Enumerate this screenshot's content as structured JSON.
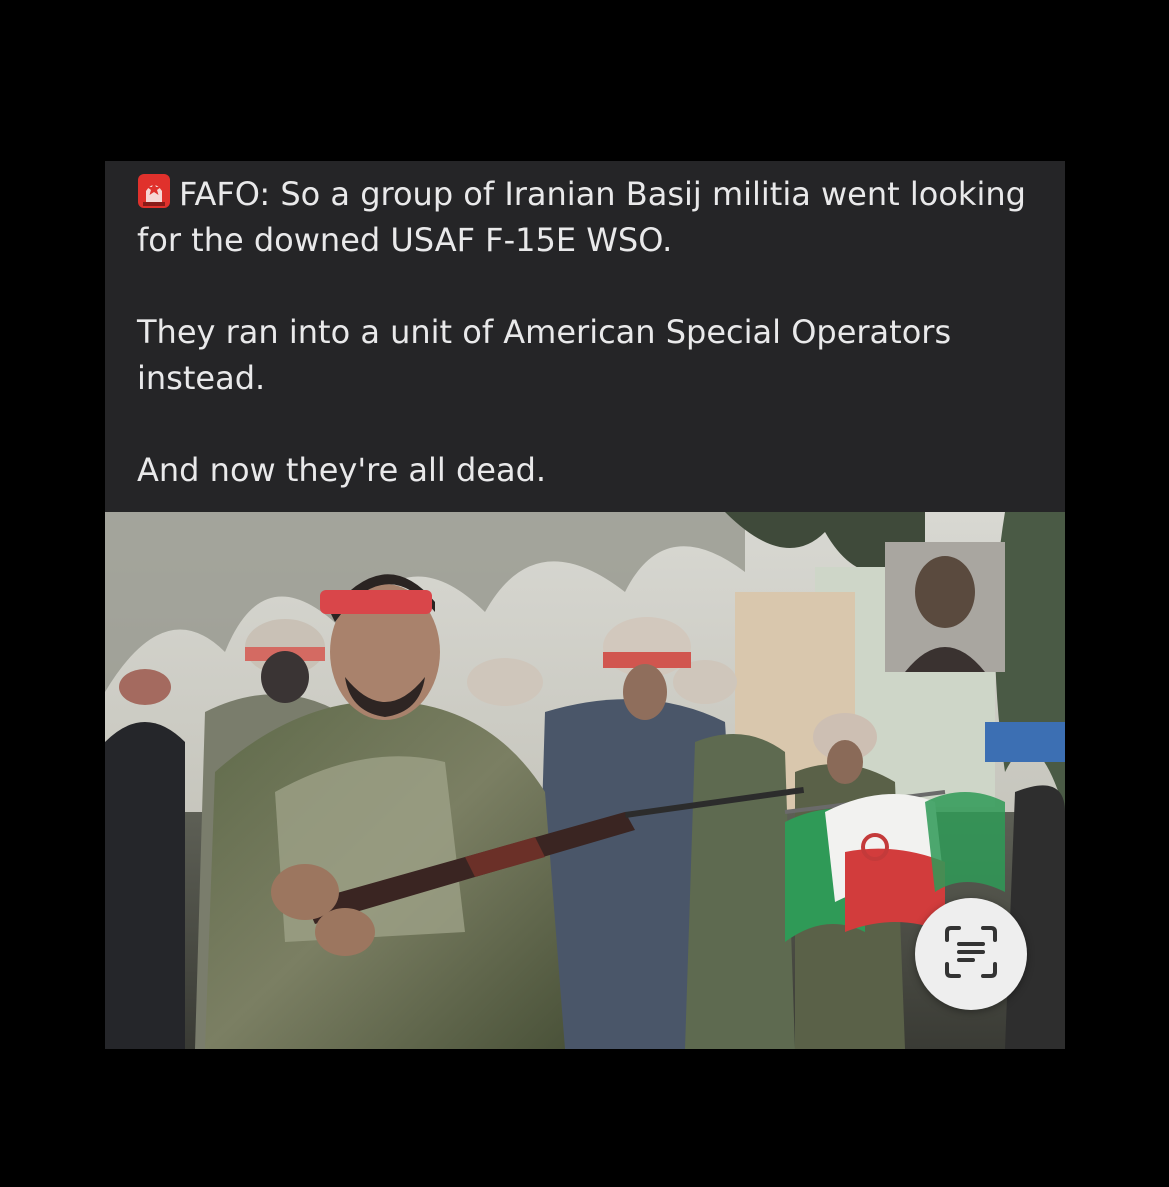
{
  "post": {
    "icon": "rotating-light-icon",
    "paragraphs": [
      "FAFO: So a group of Iranian Basij militia went looking for the downed USAF F-15E WSO.",
      "They ran into a unit of American Special Operators instead.",
      "And now they're all dead."
    ]
  },
  "photo": {
    "subject": "photo-of-basij-militia-with-rifles-and-iranian-flag"
  },
  "controls": {
    "live_text_icon": "live-text-scan-icon"
  },
  "colors": {
    "page_background": "#000000",
    "card_background": "#252527",
    "text": "#e9e9ea",
    "alert_red": "#e0312c",
    "headband_red": "#d9464a",
    "flag_green": "#2f9a57",
    "flag_red": "#d23c3c"
  }
}
